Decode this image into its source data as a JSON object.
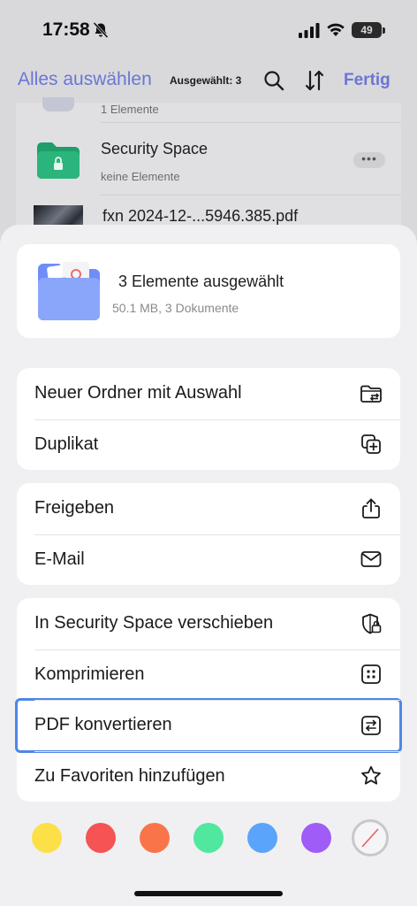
{
  "status_bar": {
    "time": "17:58",
    "battery": "49"
  },
  "nav_bar": {
    "select_all_label": "Alles auswählen",
    "selected_count": "Ausgewählt: 3",
    "done_label": "Fertig"
  },
  "file_list": {
    "prev_item_meta": "1 Elemente",
    "items": [
      {
        "title": "Security Space",
        "meta": "keine Elemente"
      },
      {
        "title": "fxn 2024-12-...5946.385.pdf"
      }
    ],
    "more_label": "•••"
  },
  "summary": {
    "title": "3 Elemente ausgewählt",
    "subtitle": "50.1 MB, 3 Dokumente"
  },
  "action_groups": [
    [
      {
        "label": "Neuer Ordner mit Auswahl",
        "icon": "new-folder-icon"
      },
      {
        "label": "Duplikat",
        "icon": "duplicate-icon"
      }
    ],
    [
      {
        "label": "Freigeben",
        "icon": "share-icon"
      },
      {
        "label": "E-Mail",
        "icon": "mail-icon"
      }
    ],
    [
      {
        "label": "In Security Space verschieben",
        "icon": "shield-lock-icon"
      },
      {
        "label": "Komprimieren",
        "icon": "compress-icon"
      },
      {
        "label": "PDF konvertieren",
        "icon": "convert-icon"
      },
      {
        "label": "Zu Favoriten hinzufügen",
        "icon": "star-icon"
      }
    ]
  ],
  "tag_colors": [
    "#fde047",
    "#f65354",
    "#fa7449",
    "#4fe89e",
    "#5aa4fb",
    "#a05cf7"
  ],
  "accent_color": "#6b76d4",
  "highlight_color": "#4f86e6"
}
